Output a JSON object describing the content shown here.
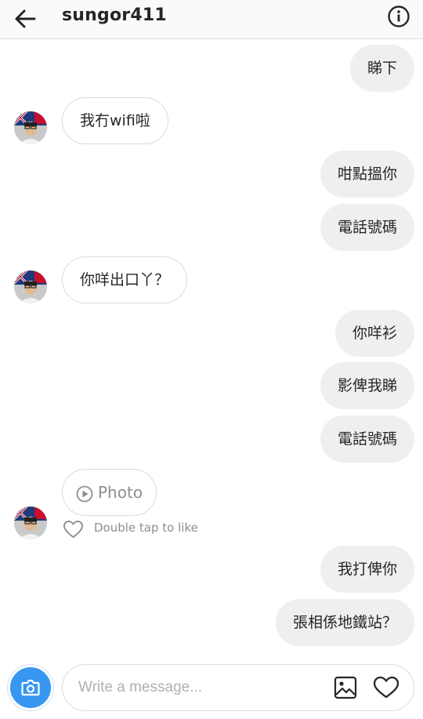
{
  "header": {
    "title": "sungor411",
    "back_icon": "arrow-left-icon",
    "info_icon": "info-circle-icon"
  },
  "messages": [
    {
      "dir": "out",
      "text": "睇下"
    },
    {
      "dir": "in",
      "text": "我冇wifi啦"
    },
    {
      "dir": "out",
      "text": "咁點搵你"
    },
    {
      "dir": "out",
      "text": "電話號碼"
    },
    {
      "dir": "in",
      "text": "你咩出口丫？"
    },
    {
      "dir": "out",
      "text": "你咩衫"
    },
    {
      "dir": "out",
      "text": "影俾我睇"
    },
    {
      "dir": "out",
      "text": "電話號碼"
    },
    {
      "dir": "in",
      "type": "photo",
      "text": "Photo",
      "icon": "play-circle-icon",
      "like_hint": "Double tap to like"
    },
    {
      "dir": "out",
      "text": "我打俾你"
    },
    {
      "dir": "out",
      "text": "張相係地鐵站？"
    }
  ],
  "composer": {
    "placeholder": "Write a message...",
    "value": "",
    "camera_icon": "camera-icon",
    "gallery_icon": "image-icon",
    "heart_icon": "heart-icon"
  },
  "colors": {
    "accent": "#3897f0",
    "outgoing_bubble": "#efefef",
    "incoming_border": "#dbdbdb",
    "hint_text": "#8e8e8e"
  }
}
